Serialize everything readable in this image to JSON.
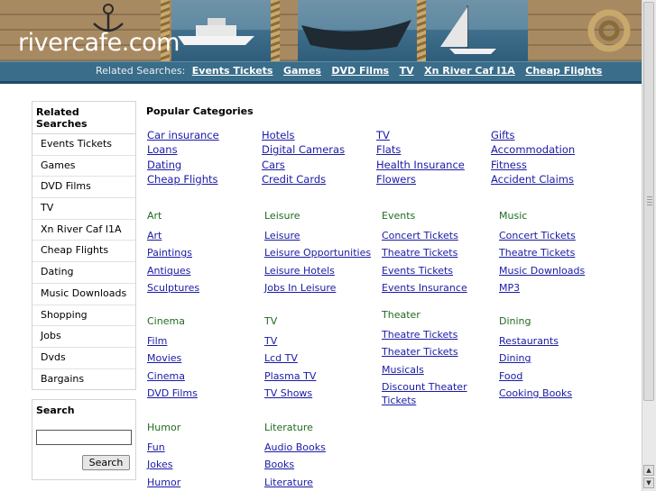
{
  "header": {
    "logo_text": "rivercafe.com"
  },
  "related_bar": {
    "prefix": "Related Searches:",
    "links": [
      "Events Tickets",
      "Games",
      "DVD Films",
      "TV",
      "Xn River Caf I1A",
      "Cheap Flights"
    ]
  },
  "sidebar": {
    "title": "Related Searches",
    "items": [
      "Events Tickets",
      "Games",
      "DVD Films",
      "TV",
      "Xn River Caf I1A",
      "Cheap Flights",
      "Dating",
      "Music Downloads",
      "Shopping",
      "Jobs",
      "Dvds",
      "Bargains"
    ],
    "search_title": "Search",
    "search_value": "",
    "search_button": "Search"
  },
  "popular": {
    "title": "Popular Categories",
    "columns": [
      [
        "Car insurance",
        "Loans",
        "Dating",
        "Cheap Flights"
      ],
      [
        "Hotels",
        "Digital Cameras",
        "Cars",
        "Credit Cards"
      ],
      [
        "TV",
        "Flats",
        "Health Insurance",
        "Flowers"
      ],
      [
        "Gifts",
        "Accommodation",
        "Fitness",
        "Accident Claims"
      ]
    ]
  },
  "categories": [
    {
      "title": "Art",
      "links": [
        "Art",
        "Paintings",
        "Antiques",
        "Sculptures"
      ]
    },
    {
      "title": "Leisure",
      "links": [
        "Leisure",
        "Leisure Opportunities",
        "Leisure Hotels",
        "Jobs In Leisure"
      ]
    },
    {
      "title": "Events",
      "links": [
        "Concert Tickets",
        "Theatre Tickets",
        "Events Tickets",
        "Events Insurance"
      ]
    },
    {
      "title": "Music",
      "links": [
        "Concert Tickets",
        "Theatre Tickets",
        "Music Downloads",
        "MP3"
      ]
    },
    {
      "title": "Cinema",
      "links": [
        "Film",
        "Movies",
        "Cinema",
        "DVD Films"
      ]
    },
    {
      "title": "TV",
      "links": [
        "TV",
        "Lcd TV",
        "Plasma TV",
        "TV Shows"
      ]
    },
    {
      "title": "Theater",
      "links": [
        "Theatre Tickets",
        "Theater Tickets",
        "Musicals",
        "Discount Theater Tickets"
      ]
    },
    {
      "title": "Dining",
      "links": [
        "Restaurants",
        "Dining",
        "Food",
        "Cooking Books"
      ]
    },
    {
      "title": "Humor",
      "links": [
        "Fun",
        "Jokes",
        "Humor"
      ]
    },
    {
      "title": "Literature",
      "links": [
        "Audio Books",
        "Books",
        "Literature"
      ]
    }
  ],
  "colors": {
    "link": "#1a1aa6",
    "category_title": "#1f6b1f",
    "bar": "#3a6d8a"
  },
  "icons": {
    "scroll_up": "up-arrow-icon",
    "scroll_down": "down-arrow-icon"
  }
}
